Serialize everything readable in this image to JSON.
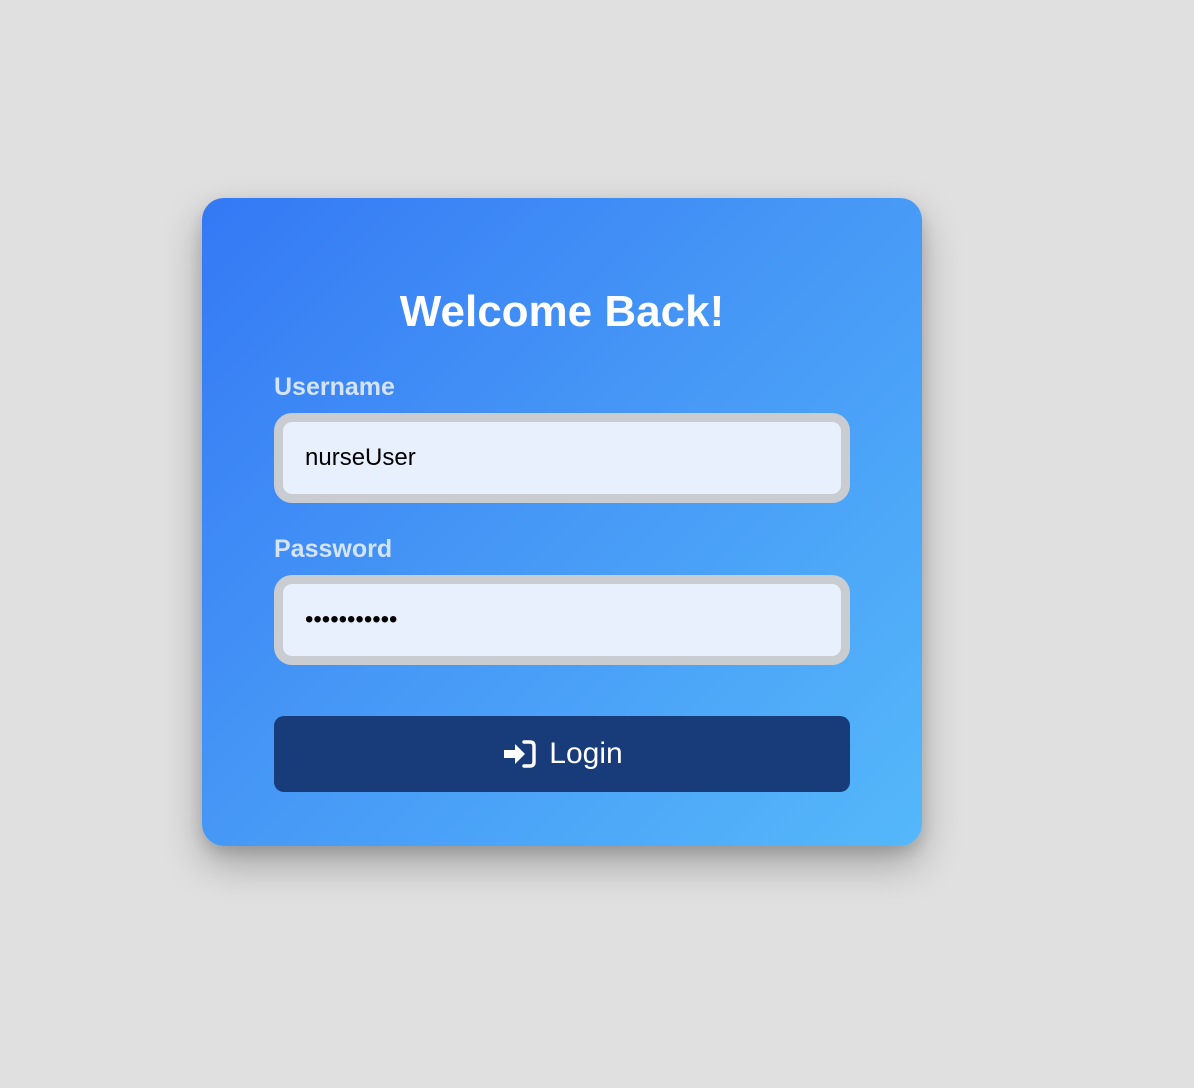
{
  "login": {
    "title": "Welcome Back!",
    "username_label": "Username",
    "username_value": "nurseUser",
    "password_label": "Password",
    "password_value": "•••••••••••",
    "login_button_label": "Login",
    "login_icon": "sign-in-icon"
  },
  "colors": {
    "page_background": "#e0e0e0",
    "card_gradient_start": "#3479f5",
    "card_gradient_end": "#55b8fa",
    "label_text": "#d4e3f5",
    "input_background": "#e8f0fe",
    "input_border": "#c9cdd2",
    "button_background": "#183c7a",
    "button_text": "#ffffff"
  }
}
